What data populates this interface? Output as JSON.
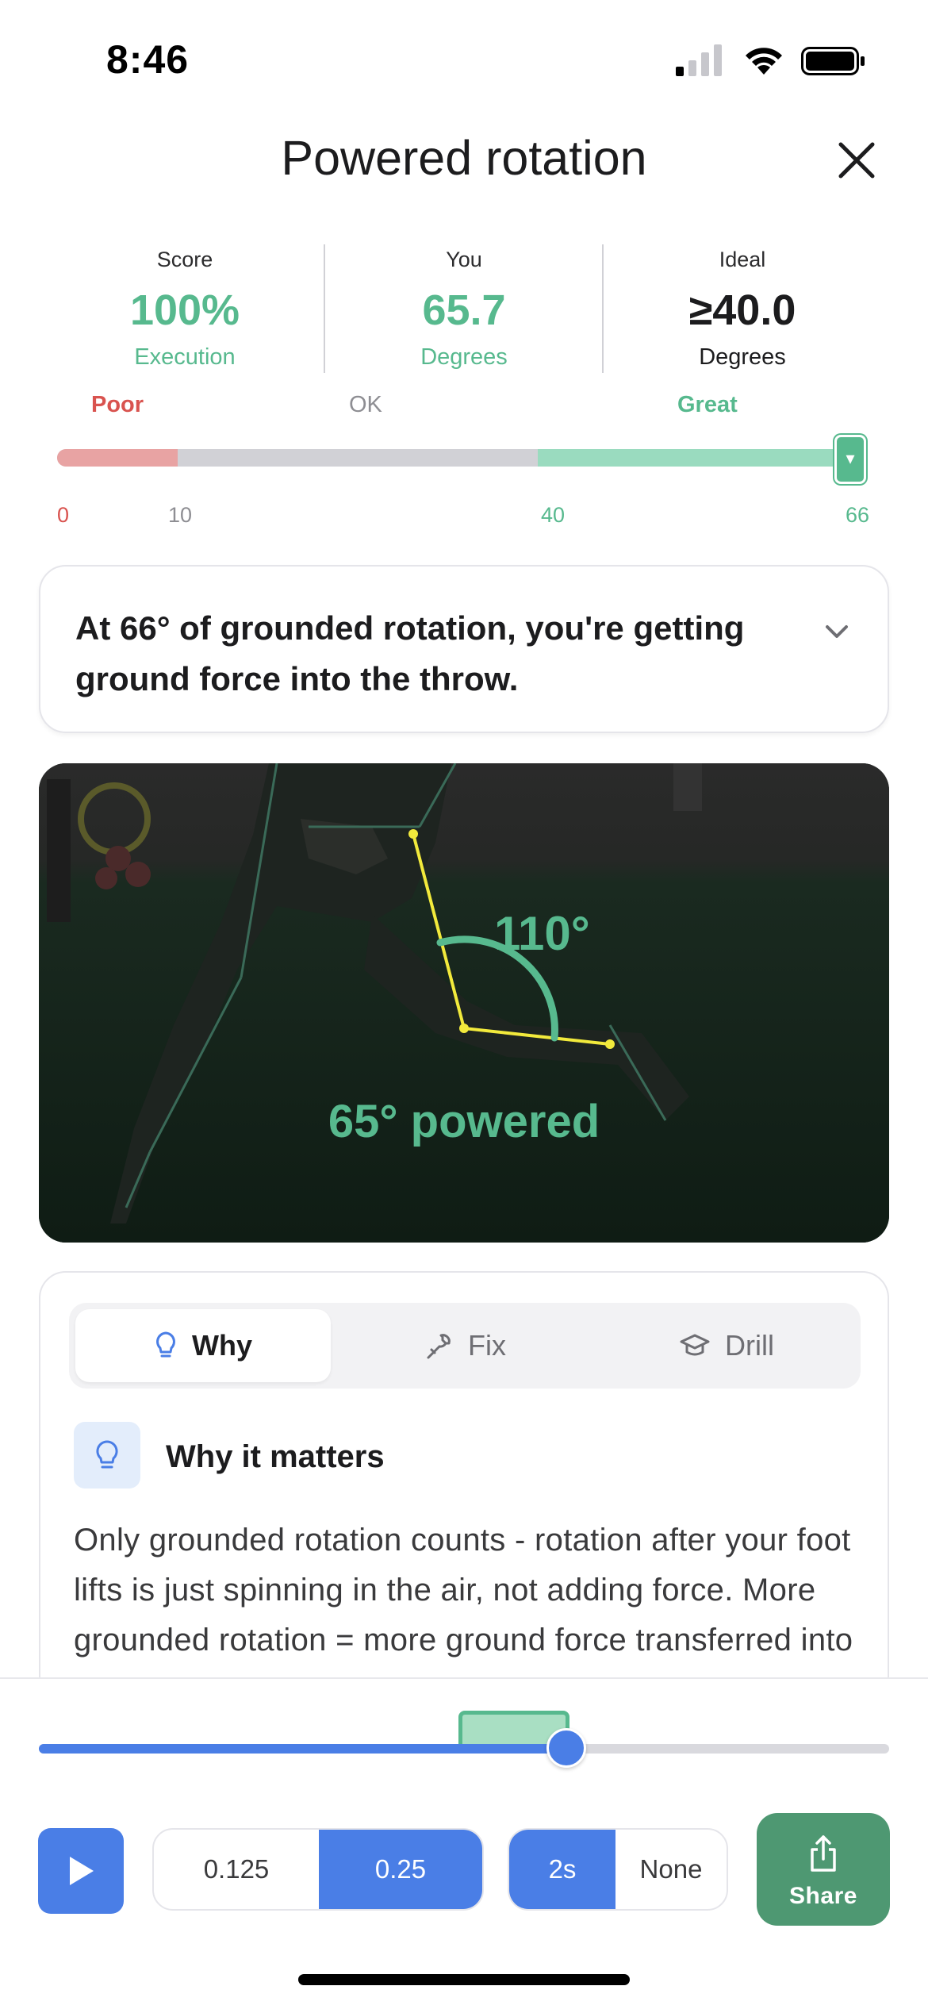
{
  "status_bar": {
    "time": "8:46"
  },
  "header": {
    "title": "Powered rotation"
  },
  "metrics": {
    "score": {
      "label": "Score",
      "value": "100%",
      "sub": "Execution"
    },
    "you": {
      "label": "You",
      "value": "65.7",
      "sub": "Degrees"
    },
    "ideal": {
      "label": "Ideal",
      "value": "≥40.0",
      "sub": "Degrees"
    }
  },
  "scale": {
    "zones": [
      "Poor",
      "OK",
      "Great"
    ],
    "ticks": [
      "0",
      "10",
      "40",
      "66"
    ],
    "marker_glyph": "▾",
    "min": 0,
    "max": 66,
    "current": 66,
    "colors": {
      "poor": "#e8a3a3",
      "ok": "#d1d1d6",
      "great": "#9adbbf",
      "accent": "#57b98e"
    }
  },
  "insight": {
    "text": "At 66° of grounded rotation, you're getting ground force into the throw."
  },
  "video": {
    "angle_label": "110°",
    "caption": "65° powered"
  },
  "tabs": [
    {
      "label": "Why",
      "icon": "lightbulb-icon",
      "active": true
    },
    {
      "label": "Fix",
      "icon": "wrench-icon",
      "active": false
    },
    {
      "label": "Drill",
      "icon": "graduation-cap-icon",
      "active": false
    }
  ],
  "why": {
    "title": "Why it matters",
    "body": "Only grounded rotation counts - rotation after your foot lifts is just spinning in the air, not adding force. More grounded rotation = more ground force transferred into the throw with the"
  },
  "playback": {
    "progress": 0.62,
    "speed_options": [
      "0.125",
      "0.25"
    ],
    "speed_selected": "0.25",
    "pause_options": [
      "2s",
      "None"
    ],
    "pause_selected": "2s",
    "share_label": "Share"
  }
}
